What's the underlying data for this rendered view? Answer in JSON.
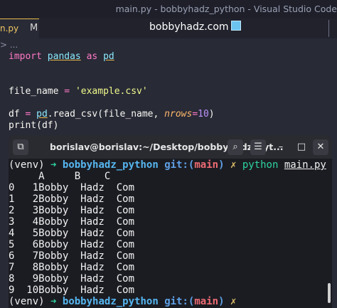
{
  "window": {
    "title": "main.py - bobbyhadz_python - Visual Studio Code",
    "brand": "bobbyhadz.com"
  },
  "tab": {
    "label": "n.py",
    "status": "M"
  },
  "breadcrumb": "> ...",
  "editor": {
    "line1": {
      "kw1": "import",
      "mod": "pandas",
      "kw2": "as",
      "alias": "pd"
    },
    "line2": {
      "name": "file_name",
      "eq": " = ",
      "str": "'example.csv'"
    },
    "line3": {
      "a": "df",
      "eq": " = ",
      "pd": "pd",
      "fn": ".read_csv(file_name, ",
      "param": "nrows",
      "eq2": "=",
      "num": "10",
      "close": ")"
    },
    "line4": "print(df)"
  },
  "terminal": {
    "title": "borislav@borislav:~/Desktop/bobbyhadz_pyt...",
    "prompt": {
      "env": "(venv)",
      "arrow": "➜",
      "dir": "bobbyhadz_python",
      "git": "git:(",
      "branch": "main",
      "gitclose": ")",
      "dirty": "✗",
      "cmd": "python",
      "file": "main.py"
    },
    "header": "     A     B    C",
    "rows": [
      "0   1Bobby  Hadz  Com",
      "1   2Bobby  Hadz  Com",
      "2   3Bobby  Hadz  Com",
      "3   4Bobby  Hadz  Com",
      "4   5Bobby  Hadz  Com",
      "5   6Bobby  Hadz  Com",
      "6   7Bobby  Hadz  Com",
      "7   8Bobby  Hadz  Com",
      "8   9Bobby  Hadz  Com",
      "9  10Bobby  Hadz  Com"
    ]
  }
}
